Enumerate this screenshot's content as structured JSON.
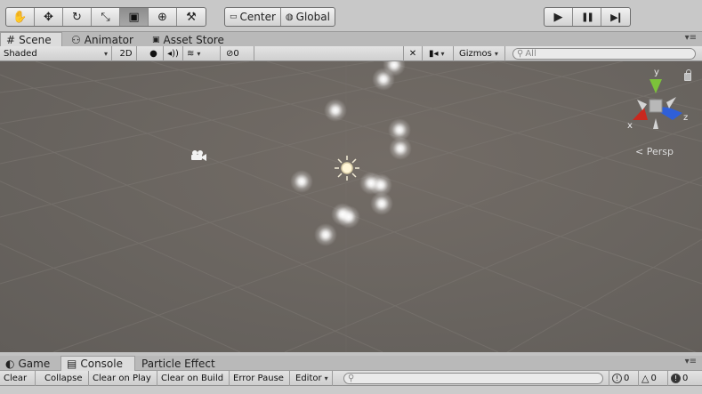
{
  "toolbar": {
    "tools": [
      {
        "name": "hand-tool",
        "glyph": "✋"
      },
      {
        "name": "move-tool",
        "glyph": "✥"
      },
      {
        "name": "rotate-tool",
        "glyph": "↻"
      },
      {
        "name": "scale-tool",
        "glyph": "⤡"
      },
      {
        "name": "rect-tool",
        "glyph": "▣"
      },
      {
        "name": "transform-tool",
        "glyph": "⊕"
      },
      {
        "name": "custom-tool",
        "glyph": "⚒"
      }
    ],
    "active_tool": "rect-tool",
    "pivot_label": "Center",
    "rotation_label": "Global",
    "play_glyph": "▶",
    "pause_glyph": "❚❚",
    "step_glyph": "▶❙"
  },
  "scene_tabs": [
    {
      "label": "Scene",
      "icon": "#"
    },
    {
      "label": "Animator",
      "icon": "⚇"
    },
    {
      "label": "Asset Store",
      "icon": "🛍"
    }
  ],
  "scene_toolbar": {
    "draw_mode": "Shaded",
    "mode_2d": "2D",
    "lighting_glyph": "💡",
    "audio_glyph": "🔊",
    "effects_glyph": "❖",
    "hidden_count": "0",
    "tools_glyph": "✗",
    "camera_glyph": "■",
    "gizmos_label": "Gizmos",
    "search_placeholder": "All"
  },
  "viewport": {
    "persp_label": "Persp",
    "axis_x": "x",
    "axis_y": "y",
    "axis_z": "z"
  },
  "bottom_tabs": [
    {
      "label": "Game",
      "icon": "◐"
    },
    {
      "label": "Console",
      "icon": "▤"
    },
    {
      "label": "Particle Effect",
      "icon": ""
    }
  ],
  "console_toolbar": {
    "buttons": [
      "Clear",
      "Collapse",
      "Clear on Play",
      "Clear on Build",
      "Error Pause"
    ],
    "editor_label": "Editor",
    "info_count": "0",
    "warning_count": "0",
    "error_count": "0"
  },
  "colors": {
    "axis_x": "#c8281e",
    "axis_y": "#7cc23a",
    "axis_z": "#2f5fd8",
    "viewport_bg": "#6a6560"
  }
}
